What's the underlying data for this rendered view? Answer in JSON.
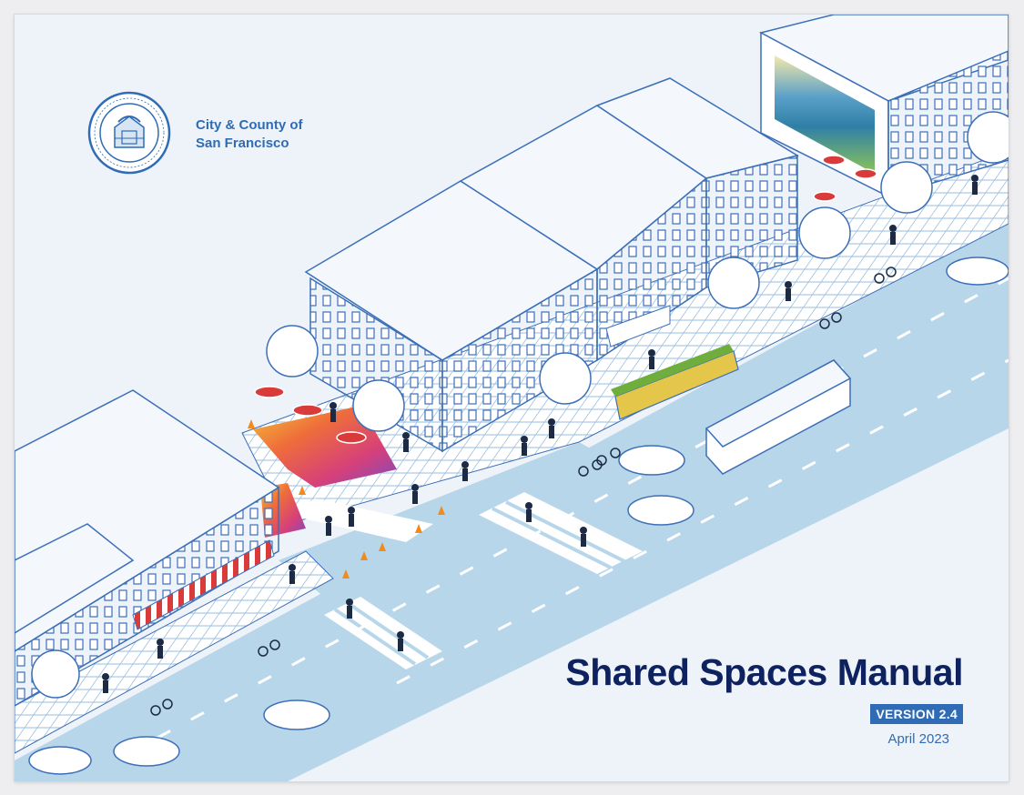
{
  "organization": {
    "line1": "City & County of",
    "line2": "San Francisco",
    "seal_icon": "city-seal-icon"
  },
  "document": {
    "title": "Shared Spaces Manual",
    "version": "VERSION 2.4",
    "date": "April 2023"
  },
  "colors": {
    "page_background": "#eef3f9",
    "brand_blue": "#2f6cb5",
    "title_navy": "#0f2260",
    "street": "#b8d6ea",
    "line_art": "#3c6fb8"
  }
}
